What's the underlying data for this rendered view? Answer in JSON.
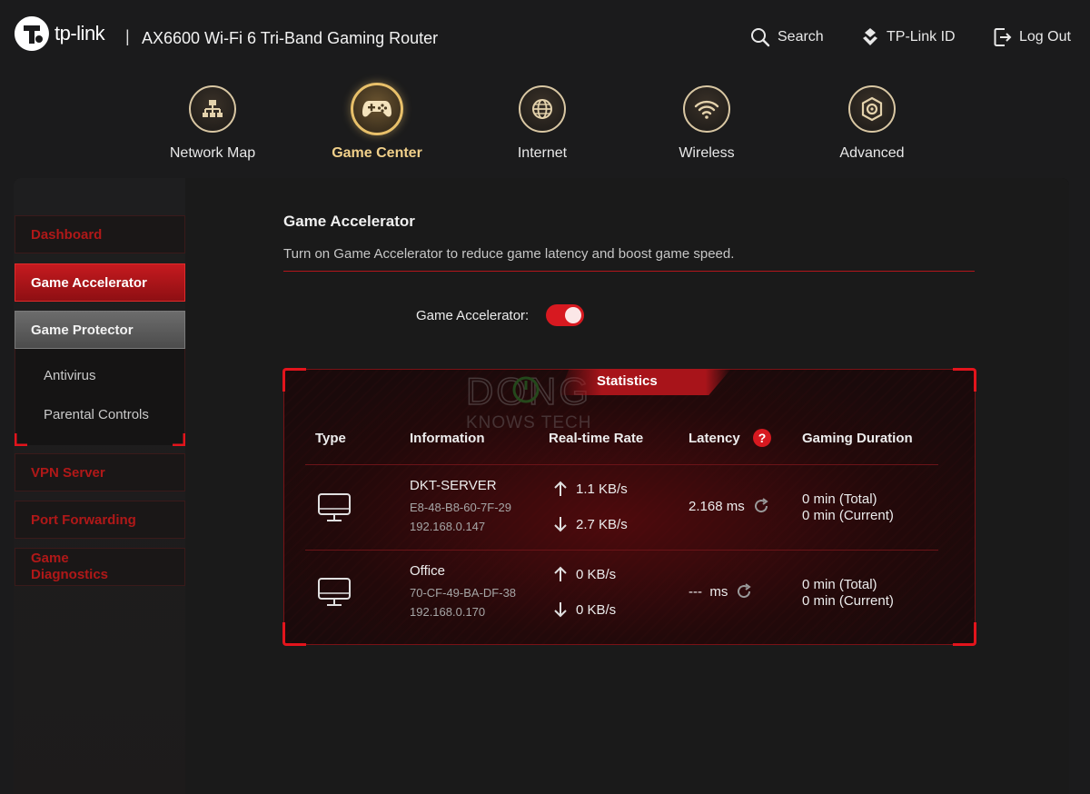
{
  "header": {
    "brand": "tp-link",
    "separator": "|",
    "product_title": "AX6600 Wi-Fi 6 Tri-Band Gaming Router",
    "actions": [
      {
        "label": "Search",
        "icon": "search-icon"
      },
      {
        "label": "TP-Link ID",
        "icon": "tplink-id-icon"
      },
      {
        "label": "Log Out",
        "icon": "logout-icon"
      }
    ]
  },
  "nav": {
    "items": [
      {
        "label": "Network Map",
        "icon": "network-map-icon",
        "active": false
      },
      {
        "label": "Game Center",
        "icon": "gamepad-icon",
        "active": true
      },
      {
        "label": "Internet",
        "icon": "globe-icon",
        "active": false
      },
      {
        "label": "Wireless",
        "icon": "wifi-icon",
        "active": false
      },
      {
        "label": "Advanced",
        "icon": "gear-icon",
        "active": false
      }
    ]
  },
  "sidebar": {
    "items": [
      {
        "label": "Dashboard",
        "state": "normal"
      },
      {
        "label": "Game Accelerator",
        "state": "active"
      },
      {
        "label": "Game Protector",
        "state": "expanded"
      },
      {
        "label": "VPN Server",
        "state": "normal"
      },
      {
        "label": "Port Forwarding",
        "state": "normal"
      },
      {
        "label": "Game Diagnostics",
        "state": "normal"
      }
    ],
    "sub_items": [
      {
        "label": "Antivirus"
      },
      {
        "label": "Parental Controls"
      }
    ]
  },
  "main": {
    "title": "Game Accelerator",
    "description": "Turn on Game Accelerator to reduce game latency and boost game speed.",
    "toggle": {
      "label": "Game Accelerator:",
      "on": true
    }
  },
  "statistics": {
    "title": "Statistics",
    "watermark_line1": "DONG",
    "watermark_line2": "KNOWS TECH",
    "columns": [
      "Type",
      "Information",
      "Real-time Rate",
      "Latency",
      "Gaming Duration"
    ],
    "latency_help": "?",
    "devices": [
      {
        "name": "DKT-SERVER",
        "mac": "E8-48-B8-60-7F-29",
        "ip": "192.168.0.147",
        "upload": "1.1 KB/s",
        "download": "2.7 KB/s",
        "latency": "2.168 ms",
        "total": "0 min (Total)",
        "current": "0 min (Current)"
      },
      {
        "name": "Office",
        "mac": "70-CF-49-BA-DF-38",
        "ip": "192.168.0.170",
        "upload": "0 KB/s",
        "download": "0 KB/s",
        "latency": "---  ms",
        "total": "0 min (Total)",
        "current": "0 min (Current)"
      }
    ]
  },
  "colors": {
    "accent_red": "#d71920",
    "gold": "#e8c06a",
    "background": "#1b1b1c"
  }
}
